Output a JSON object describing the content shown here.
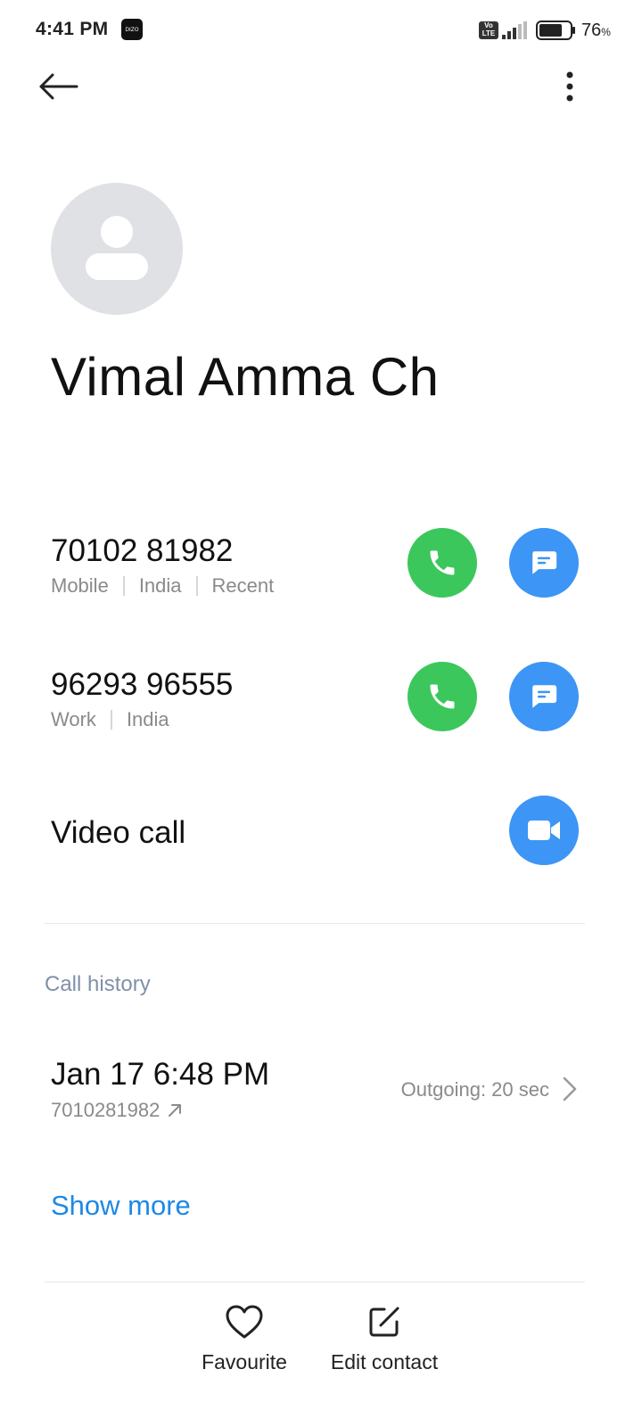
{
  "status_bar": {
    "time": "4:41 PM",
    "app_badge": "DIZO",
    "volte": "Vo LTE",
    "battery_percent": "76",
    "battery_unit": "%"
  },
  "toolbar": {
    "back_icon": "arrow-left-icon",
    "more_icon": "more-vertical-icon"
  },
  "contact": {
    "avatar_icon": "person-placeholder-icon",
    "name": "Vimal Amma Ch"
  },
  "phones": [
    {
      "number": "70102 81982",
      "type": "Mobile",
      "region": "India",
      "tag": "Recent"
    },
    {
      "number": "96293 96555",
      "type": "Work",
      "region": "India"
    }
  ],
  "video_call": {
    "label": "Video call",
    "icon": "video-camera-icon"
  },
  "call_history": {
    "title": "Call history",
    "items": [
      {
        "date": "Jan 17 6:48 PM",
        "number": "7010281982",
        "direction_icon": "outgoing-arrow-icon",
        "detail": "Outgoing: 20 sec"
      }
    ],
    "show_more": "Show more"
  },
  "bottom_actions": {
    "favourite": "Favourite",
    "edit": "Edit contact"
  },
  "colors": {
    "call_green": "#3cc75d",
    "message_blue": "#3d95f5",
    "link_blue": "#1e88e5",
    "section_title": "#8090a8"
  }
}
